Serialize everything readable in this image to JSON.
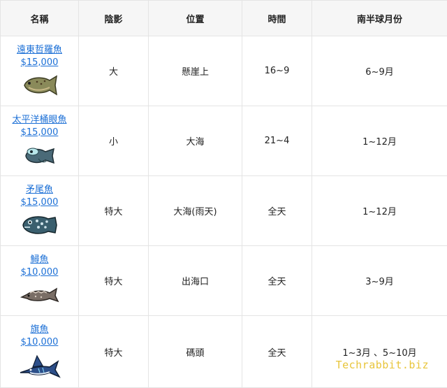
{
  "table": {
    "headers": [
      "名稱",
      "陰影",
      "位置",
      "時間",
      "南半球月份"
    ],
    "rows": [
      {
        "name": "遠東哲羅魚",
        "price": "$15,000",
        "shadow": "大",
        "location": "懸崖上",
        "time": "16~9",
        "months": "6~9月",
        "icon": "taimen-fish-icon",
        "color": "#8a8a5a"
      },
      {
        "name": "太平洋桶眼魚",
        "price": "$15,000",
        "shadow": "小",
        "location": "大海",
        "time": "21~4",
        "months": "1~12月",
        "icon": "barreleye-fish-icon",
        "color": "#4a6a78"
      },
      {
        "name": "矛尾魚",
        "price": "$15,000",
        "shadow": "特大",
        "location": "大海(雨天)",
        "time": "全天",
        "months": "1~12月",
        "icon": "coelacanth-fish-icon",
        "color": "#3a5f6e"
      },
      {
        "name": "鱘魚",
        "price": "$10,000",
        "shadow": "特大",
        "location": "出海口",
        "time": "全天",
        "months": "3~9月",
        "icon": "sturgeon-fish-icon",
        "color": "#7a6e66"
      },
      {
        "name": "旗魚",
        "price": "$10,000",
        "shadow": "特大",
        "location": "碼頭",
        "time": "全天",
        "months": "1~3月 、5~10月",
        "icon": "marlin-fish-icon",
        "color": "#2c4f8a"
      }
    ]
  },
  "watermark": "Techrabbit.biz"
}
